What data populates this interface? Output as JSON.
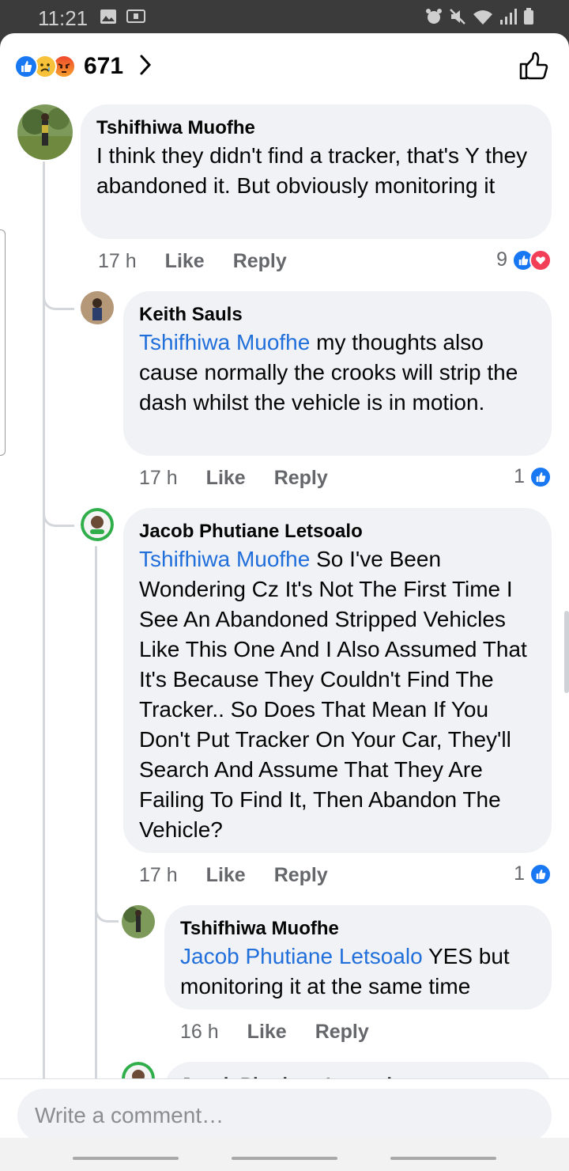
{
  "status": {
    "time": "11:21"
  },
  "reactions": {
    "count": "671",
    "types": [
      "like-icon",
      "sad-icon",
      "angry-icon"
    ]
  },
  "comments": [
    {
      "author": "Tshifhiwa Muofhe",
      "text": "I think they didn't find a tracker, that's Y they abandoned it. But obviously monitoring it",
      "time": "17 h",
      "like_label": "Like",
      "reply_label": "Reply",
      "reaction_count": "9"
    },
    {
      "author": "Keith Sauls",
      "mention": "Tshifhiwa Muofhe",
      "text": " my thoughts also cause normally the crooks will strip the dash whilst the vehicle is in motion.",
      "time": "17 h",
      "like_label": "Like",
      "reply_label": "Reply",
      "reaction_count": "1"
    },
    {
      "author": "Jacob Phutiane Letsoalo",
      "mention": "Tshifhiwa Muofhe",
      "text": " So I've Been Wondering Cz It's Not The First Time I See An Abandoned Stripped Vehicles Like This One And I Also Assumed That It's Because They Couldn't Find The Tracker.. So Does That Mean If You Don't Put Tracker On Your Car, They'll Search And Assume That They Are Failing To Find It, Then Abandon The Vehicle?",
      "time": "17 h",
      "like_label": "Like",
      "reply_label": "Reply",
      "reaction_count": "1"
    },
    {
      "author": "Tshifhiwa Muofhe",
      "mention": "Jacob Phutiane Letsoalo",
      "text": " YES but monitoring it at the same time",
      "time": "16 h",
      "like_label": "Like",
      "reply_label": "Reply"
    },
    {
      "author": "Jacob Phutiane Letsoalo"
    }
  ],
  "composer": {
    "placeholder": "Write a comment…"
  },
  "colors": {
    "accent": "#1877f2",
    "mention": "#216fdb",
    "bubble": "#f0f2f5",
    "love": "#f33e58"
  }
}
